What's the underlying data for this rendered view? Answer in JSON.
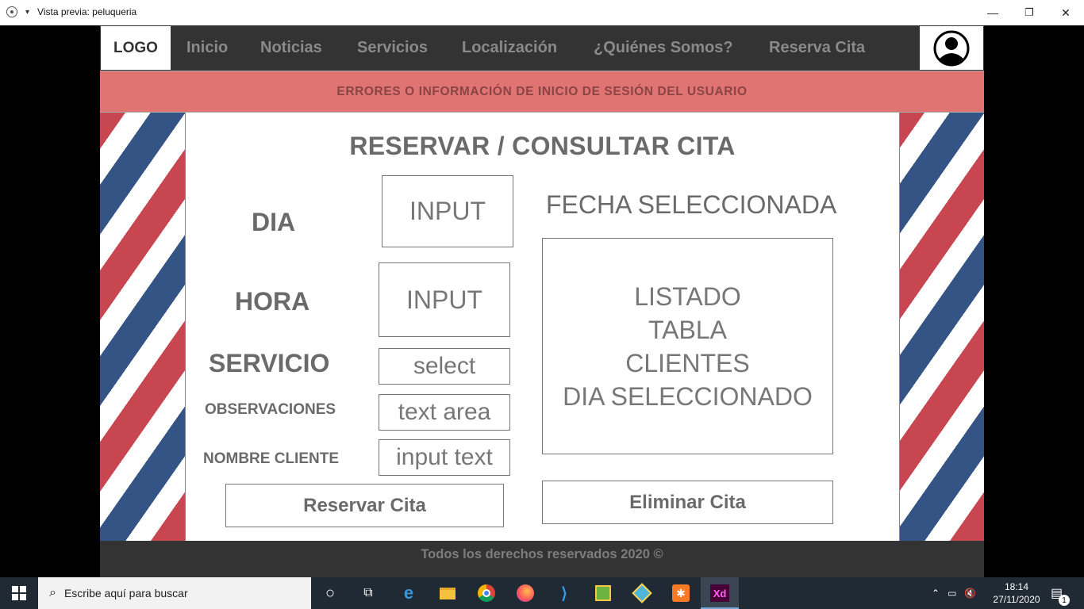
{
  "window": {
    "title": "Vista previa: peluqueria",
    "minimize": "—",
    "restore": "❐",
    "close": "✕"
  },
  "nav": {
    "logo": "LOGO",
    "items": [
      "Inicio",
      "Noticias",
      "Servicios",
      "Localización",
      "¿Quiénes Somos?",
      "Reserva Cita"
    ]
  },
  "banner": "ERRORES O INFORMACIÓN DE INICIO DE SESIÓN DEL USUARIO",
  "form": {
    "title": "RESERVAR / CONSULTAR CITA",
    "dia_label": "DIA",
    "dia_input": "INPUT",
    "hora_label": "HORA",
    "hora_input": "INPUT",
    "servicio_label": "SERVICIO",
    "servicio_select": "select",
    "observaciones_label": "OBSERVACIONES",
    "observaciones_textarea": "text area",
    "nombre_label": "NOMBRE CLIENTE",
    "nombre_input": "input text",
    "reservar_button": "Reservar Cita"
  },
  "side": {
    "fecha": "FECHA SELECCIONADA",
    "listado_lines": [
      "LISTADO",
      "TABLA",
      "CLIENTES",
      "DIA SELECCIONADO"
    ],
    "eliminar_button": "Eliminar Cita"
  },
  "footer": "Todos los derechos reservados 2020 ©",
  "taskbar": {
    "search_placeholder": "Escribe aquí para buscar",
    "time": "18:14",
    "date": "27/11/2020",
    "notification_count": "1",
    "xd_label": "Xd"
  },
  "colors": {
    "nav_bg": "#333333",
    "banner_bg": "#e07472",
    "stripe_red": "#c8464f",
    "stripe_blue": "#345486",
    "taskbar_bg": "#1f2a35"
  }
}
